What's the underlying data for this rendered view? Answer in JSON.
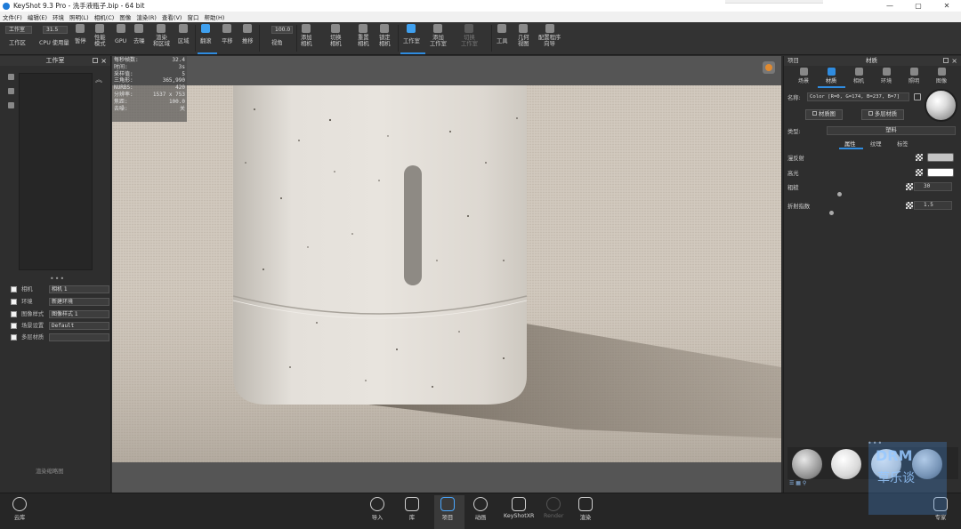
{
  "window": {
    "title": "KeyShot 9.3 Pro - 洗手液瓶子.bip - 64 bit",
    "controls": [
      "—",
      "▢",
      "✕"
    ]
  },
  "menubar": {
    "items": [
      "文件(F)",
      "编辑(E)",
      "环境",
      "照明(L)",
      "相机(C)",
      "图像",
      "渲染(R)",
      "查看(V)",
      "窗口",
      "帮助(H)"
    ]
  },
  "toolbar": {
    "workspace_value": "工作室",
    "workspace_label": "工作区",
    "cpu_value": "31.5",
    "cpu_label": "CPU 使用量",
    "pause": "暂停",
    "perf_mode": [
      "性能",
      "模式"
    ],
    "gpu": "GPU",
    "denoise": "去噪",
    "render_region": [
      "渲染",
      "和区域"
    ],
    "region": "区域",
    "tumble": "翻滚",
    "pan": "平移",
    "dolly": "推移",
    "fov_value": "100.0",
    "fov": "视角",
    "add_camera": [
      "添加",
      "相机"
    ],
    "switch_camera": [
      "切换",
      "相机"
    ],
    "reset_camera": [
      "重置",
      "相机"
    ],
    "lock_camera": [
      "锁定",
      "相机"
    ],
    "studio": "工作室",
    "add_studio": [
      "添加",
      "工作室"
    ],
    "switch_studio": [
      "切换",
      "工作室"
    ],
    "tools": "工具",
    "geometry_view": [
      "几何",
      "视图"
    ],
    "config_program": [
      "配置程序",
      "向导"
    ]
  },
  "leftpanel": {
    "title": "工作室",
    "options": [
      {
        "label": "相机",
        "value": "相机 1"
      },
      {
        "label": "环境",
        "value": "新建环境"
      },
      {
        "label": "图像样式",
        "value": "图像样式 1"
      },
      {
        "label": "场景设置",
        "value": "Default"
      },
      {
        "label": "多层材质",
        "value": ""
      }
    ],
    "render_button": "渲染缩略图"
  },
  "stats": {
    "rows": [
      {
        "k": "每秒帧数:",
        "v": "32.4"
      },
      {
        "k": "时间:",
        "v": "3s"
      },
      {
        "k": "采样值:",
        "v": "5"
      },
      {
        "k": "三角形:",
        "v": "365,990"
      },
      {
        "k": "NURBS:",
        "v": "420"
      },
      {
        "k": "分辨率:",
        "v": "1537 x 753"
      },
      {
        "k": "焦距:",
        "v": "100.0"
      },
      {
        "k": "去噪:",
        "v": "关"
      }
    ]
  },
  "rightpanel": {
    "left_title": "项目",
    "title": "材质",
    "tabs": [
      "场景",
      "材质",
      "相机",
      "环境",
      "照明",
      "图像"
    ],
    "name_label": "名称:",
    "name_value": "Color [R=0, G=174, B=237, B=7]",
    "material_graph": "材质图",
    "multi_material": "多层材质",
    "type_label": "类型:",
    "type_value": "塑料",
    "sub_tabs": [
      "属性",
      "纹理",
      "标签"
    ],
    "props": {
      "diffuse": "漫反射",
      "specular": "高光",
      "roughness": "粗糙",
      "roughness_value": "30",
      "ior": "折射指数",
      "ior_value": "1.5"
    },
    "colors": {
      "diffuse": "#c4c4c4",
      "specular": "#ffffff"
    }
  },
  "bottombar": {
    "cloud": "云库",
    "items": [
      "导入",
      "库",
      "项目",
      "动画",
      "KeyShotXR",
      "Render",
      "渲染"
    ],
    "expert": "专家"
  },
  "watermark": {
    "line1": "DRM",
    "line2": "草乐谈"
  }
}
